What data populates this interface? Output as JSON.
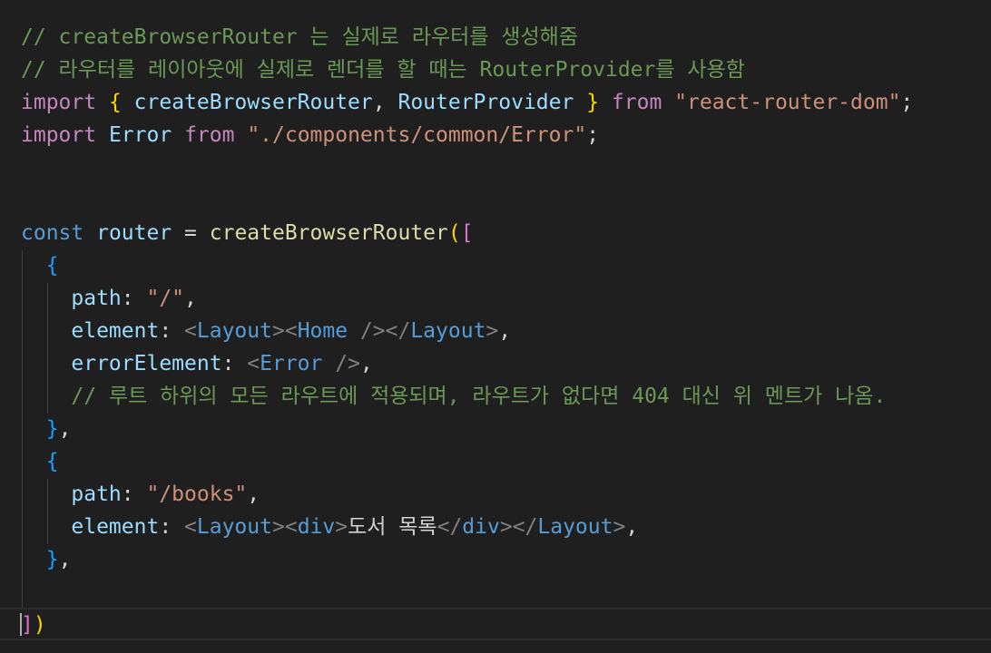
{
  "editor": {
    "lines": [
      {
        "tokens": [
          {
            "t": "// createBrowserRouter 는 실제로 라우터를 생성해줌",
            "c": "c-comment"
          }
        ]
      },
      {
        "tokens": [
          {
            "t": "// 라우터를 레이아웃에 실제로 렌더를 할 때는 RouterProvider를 사용함",
            "c": "c-comment"
          }
        ]
      },
      {
        "tokens": [
          {
            "t": "import",
            "c": "c-kw2"
          },
          {
            "t": " ",
            "c": "c-plain"
          },
          {
            "t": "{",
            "c": "c-b1"
          },
          {
            "t": " createBrowserRouter",
            "c": "c-var"
          },
          {
            "t": ",",
            "c": "c-plain"
          },
          {
            "t": " RouterProvider",
            "c": "c-var"
          },
          {
            "t": " ",
            "c": "c-plain"
          },
          {
            "t": "}",
            "c": "c-b1"
          },
          {
            "t": " ",
            "c": "c-plain"
          },
          {
            "t": "from",
            "c": "c-kw2"
          },
          {
            "t": " ",
            "c": "c-plain"
          },
          {
            "t": "\"react-router-dom\"",
            "c": "c-str"
          },
          {
            "t": ";",
            "c": "c-plain"
          }
        ]
      },
      {
        "tokens": [
          {
            "t": "import",
            "c": "c-kw2"
          },
          {
            "t": " ",
            "c": "c-plain"
          },
          {
            "t": "Error",
            "c": "c-var"
          },
          {
            "t": " ",
            "c": "c-plain"
          },
          {
            "t": "from",
            "c": "c-kw2"
          },
          {
            "t": " ",
            "c": "c-plain"
          },
          {
            "t": "\"./components/common/Error\"",
            "c": "c-str"
          },
          {
            "t": ";",
            "c": "c-plain"
          }
        ]
      },
      {
        "tokens": []
      },
      {
        "tokens": []
      },
      {
        "tokens": [
          {
            "t": "const",
            "c": "c-kw"
          },
          {
            "t": " ",
            "c": "c-plain"
          },
          {
            "t": "router",
            "c": "c-var"
          },
          {
            "t": " = ",
            "c": "c-plain"
          },
          {
            "t": "createBrowserRouter",
            "c": "c-fn"
          },
          {
            "t": "(",
            "c": "c-b1"
          },
          {
            "t": "[",
            "c": "c-b2"
          }
        ]
      },
      {
        "tokens": [
          {
            "t": "  ",
            "c": "c-plain"
          },
          {
            "t": "{",
            "c": "c-b3"
          }
        ]
      },
      {
        "tokens": [
          {
            "t": "    ",
            "c": "c-plain"
          },
          {
            "t": "path",
            "c": "c-var"
          },
          {
            "t": ": ",
            "c": "c-plain"
          },
          {
            "t": "\"/\"",
            "c": "c-str"
          },
          {
            "t": ",",
            "c": "c-plain"
          }
        ]
      },
      {
        "tokens": [
          {
            "t": "    ",
            "c": "c-plain"
          },
          {
            "t": "element",
            "c": "c-var"
          },
          {
            "t": ": ",
            "c": "c-plain"
          },
          {
            "t": "<",
            "c": "c-tagb"
          },
          {
            "t": "Layout",
            "c": "c-kw"
          },
          {
            "t": "><",
            "c": "c-tagb"
          },
          {
            "t": "Home",
            "c": "c-kw"
          },
          {
            "t": " /></",
            "c": "c-tagb"
          },
          {
            "t": "Layout",
            "c": "c-kw"
          },
          {
            "t": ">",
            "c": "c-tagb"
          },
          {
            "t": ",",
            "c": "c-plain"
          }
        ]
      },
      {
        "tokens": [
          {
            "t": "    ",
            "c": "c-plain"
          },
          {
            "t": "errorElement",
            "c": "c-var"
          },
          {
            "t": ": ",
            "c": "c-plain"
          },
          {
            "t": "<",
            "c": "c-tagb"
          },
          {
            "t": "Error",
            "c": "c-kw"
          },
          {
            "t": " />",
            "c": "c-tagb"
          },
          {
            "t": ",",
            "c": "c-plain"
          }
        ]
      },
      {
        "tokens": [
          {
            "t": "    ",
            "c": "c-plain"
          },
          {
            "t": "// 루트 하위의 모든 라우트에 적용되며, 라우트가 없다면 404 대신 위 멘트가 나옴.",
            "c": "c-comment"
          }
        ]
      },
      {
        "tokens": [
          {
            "t": "  ",
            "c": "c-plain"
          },
          {
            "t": "}",
            "c": "c-b3"
          },
          {
            "t": ",",
            "c": "c-plain"
          }
        ]
      },
      {
        "tokens": [
          {
            "t": "  ",
            "c": "c-plain"
          },
          {
            "t": "{",
            "c": "c-b3"
          }
        ]
      },
      {
        "tokens": [
          {
            "t": "    ",
            "c": "c-plain"
          },
          {
            "t": "path",
            "c": "c-var"
          },
          {
            "t": ": ",
            "c": "c-plain"
          },
          {
            "t": "\"/books\"",
            "c": "c-str"
          },
          {
            "t": ",",
            "c": "c-plain"
          }
        ]
      },
      {
        "tokens": [
          {
            "t": "    ",
            "c": "c-plain"
          },
          {
            "t": "element",
            "c": "c-var"
          },
          {
            "t": ": ",
            "c": "c-plain"
          },
          {
            "t": "<",
            "c": "c-tagb"
          },
          {
            "t": "Layout",
            "c": "c-kw"
          },
          {
            "t": "><",
            "c": "c-tagb"
          },
          {
            "t": "div",
            "c": "c-kw"
          },
          {
            "t": ">",
            "c": "c-tagb"
          },
          {
            "t": "도서 목록",
            "c": "c-plain"
          },
          {
            "t": "</",
            "c": "c-tagb"
          },
          {
            "t": "div",
            "c": "c-kw"
          },
          {
            "t": "></",
            "c": "c-tagb"
          },
          {
            "t": "Layout",
            "c": "c-kw"
          },
          {
            "t": ">",
            "c": "c-tagb"
          },
          {
            "t": ",",
            "c": "c-plain"
          }
        ]
      },
      {
        "tokens": [
          {
            "t": "  ",
            "c": "c-plain"
          },
          {
            "t": "}",
            "c": "c-b3"
          },
          {
            "t": ",",
            "c": "c-plain"
          }
        ]
      },
      {
        "tokens": []
      },
      {
        "tokens": [
          {
            "t": "]",
            "c": "c-b2"
          },
          {
            "t": ")",
            "c": "c-b1"
          }
        ]
      }
    ]
  },
  "colors": {
    "background": "#1f1f1f",
    "comment": "#6a9955",
    "keyword": "#569cd6",
    "control_keyword": "#c586c0",
    "string": "#ce9178",
    "variable": "#9cdcfe",
    "function": "#dcdcaa"
  }
}
